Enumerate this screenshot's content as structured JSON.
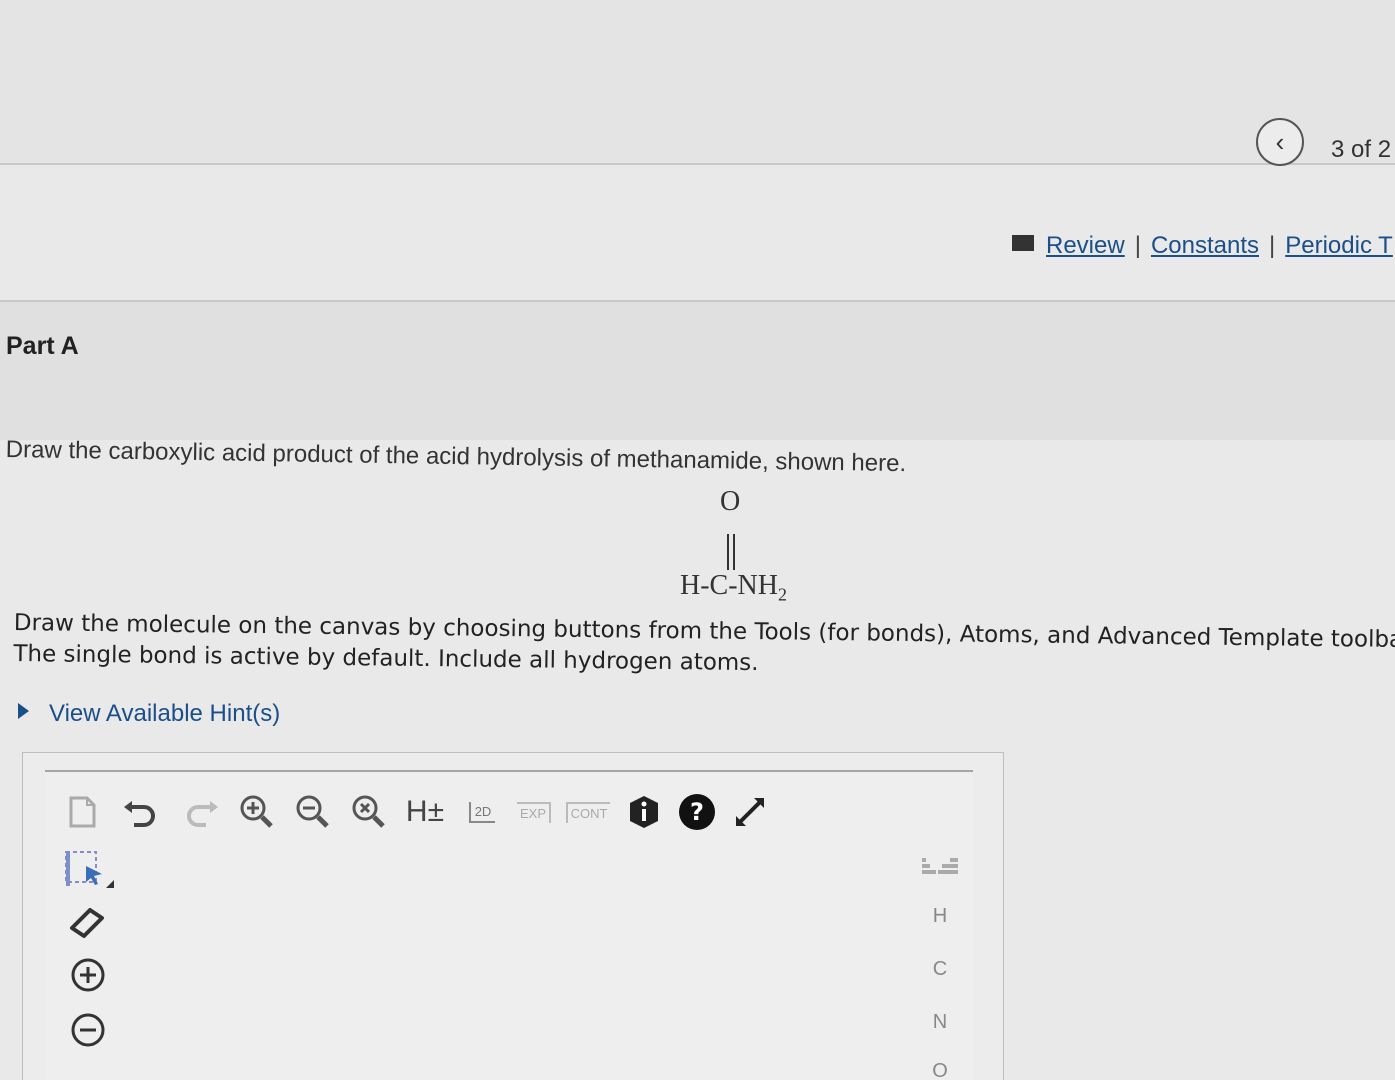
{
  "navigation": {
    "counter": "3 of 2"
  },
  "resources": {
    "review": "Review",
    "constants": "Constants",
    "periodic": "Periodic T"
  },
  "part": {
    "title": "Part A"
  },
  "question": {
    "text": "Draw the carboxylic acid product of the acid hydrolysis of methanamide, shown here.",
    "molecule": {
      "top_atom": "O",
      "formula_main": "H-C-NH",
      "formula_sub": "2"
    }
  },
  "instructions": {
    "line1": "Draw the molecule on the canvas by choosing buttons from the Tools (for bonds), Atoms, and Advanced Template toolba",
    "line2": "The single bond is active by default. Include all hydrogen atoms."
  },
  "hints": {
    "label": "View Available Hint(s)"
  },
  "toolbar": {
    "hydrogen": "H±",
    "label_2d": "2D",
    "label_exp": "EXP",
    "label_cont": "CONT"
  },
  "atoms": [
    "H",
    "C",
    "N",
    "O"
  ],
  "colors": {
    "link": "#1b4f8a",
    "background": "#e9e9e9",
    "icon_dark": "#222222"
  },
  "icons": [
    "chevron-left-icon",
    "book-icon",
    "new-document-icon",
    "undo-icon",
    "redo-icon",
    "zoom-in-icon",
    "zoom-out-icon",
    "zoom-reset-icon",
    "info-icon",
    "help-icon",
    "fullscreen-icon",
    "selection-tool-icon",
    "eraser-icon",
    "plus-charge-icon",
    "minus-charge-icon",
    "periodic-table-icon"
  ]
}
